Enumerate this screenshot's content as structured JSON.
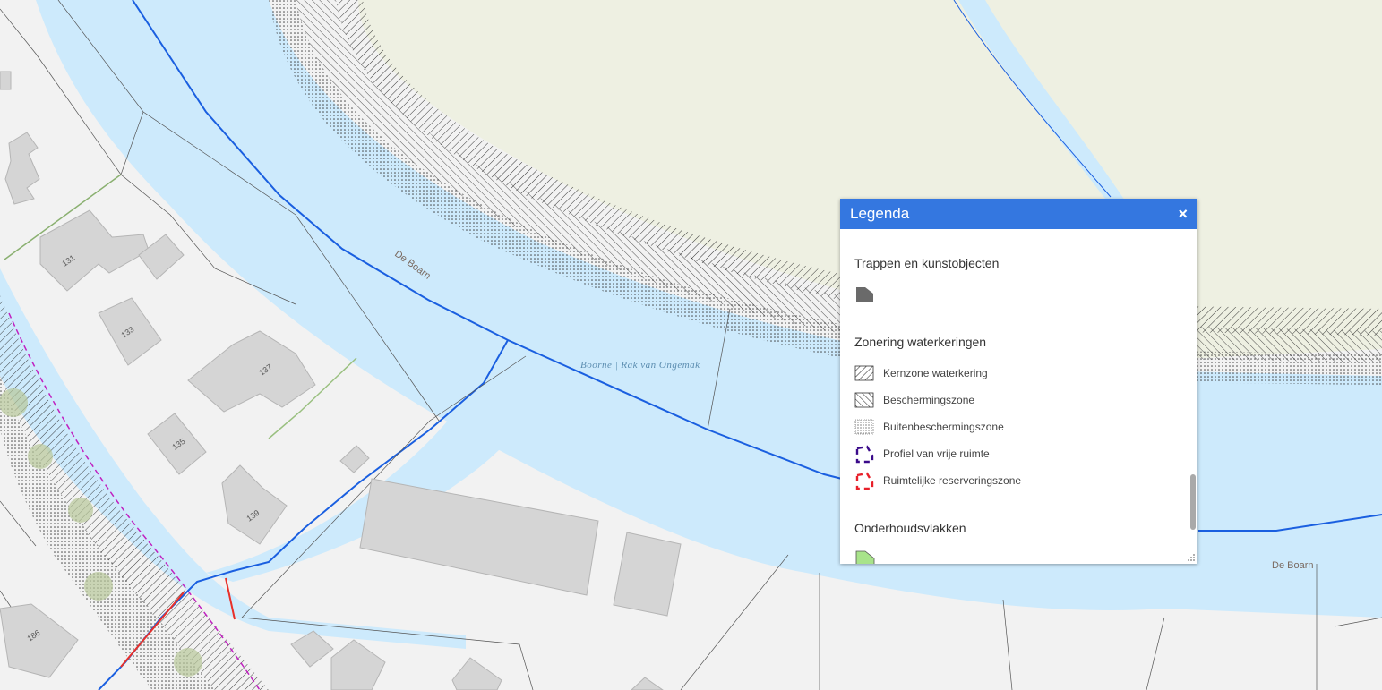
{
  "map": {
    "labels": {
      "river_upper": "De Boarn",
      "river_lower": "De Boarn",
      "water_name": "Boorne | Rak van Ongemak"
    },
    "house_numbers": [
      "131",
      "133",
      "137",
      "135",
      "139",
      "186"
    ]
  },
  "legend": {
    "title": "Legenda",
    "close_symbol": "×",
    "sections": [
      {
        "title": "Trappen en kunstobjecten",
        "items": []
      },
      {
        "title": "Zonering waterkeringen",
        "items": [
          {
            "label": "Kernzone waterkering",
            "icon": "hatch-forward-icon"
          },
          {
            "label": "Beschermingszone",
            "icon": "hatch-back-icon"
          },
          {
            "label": "Buitenbeschermingszone",
            "icon": "dots-icon"
          },
          {
            "label": "Profiel van vrije ruimte",
            "icon": "purple-dashed-icon",
            "color": "#3a0a8a"
          },
          {
            "label": "Ruimtelijke reserveringszone",
            "icon": "red-dashed-icon",
            "color": "#e8202a"
          }
        ]
      },
      {
        "title": "Onderhoudsvlakken",
        "items": []
      }
    ]
  },
  "colors": {
    "header": "#3477e0",
    "water": "#cdeafc",
    "land": "#f2f2f2",
    "field": "#eef0e2",
    "building": "#d5d5d5",
    "waterline": "#1a5fe0",
    "maintenance": "#a8e38a"
  }
}
